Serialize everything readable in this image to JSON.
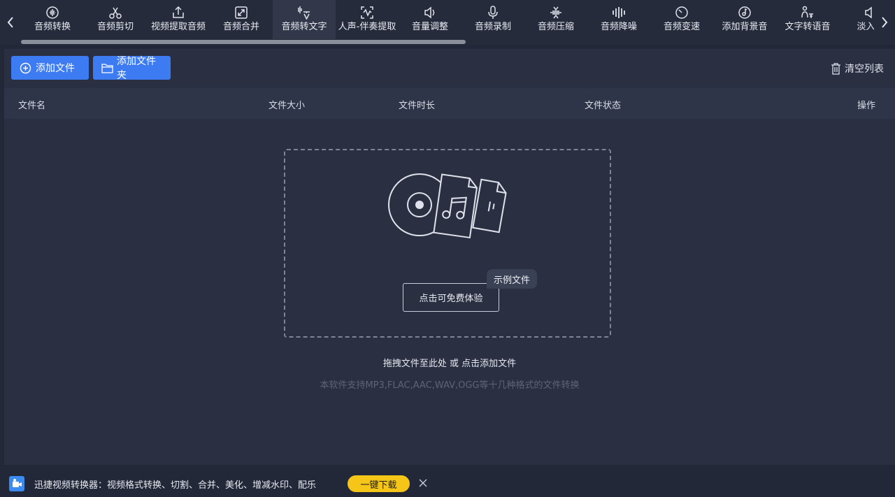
{
  "toolbar": {
    "tools": [
      {
        "label": "音频转换",
        "icon": "audio-convert-icon"
      },
      {
        "label": "音频剪切",
        "icon": "scissors-icon"
      },
      {
        "label": "视频提取音频",
        "icon": "export-icon"
      },
      {
        "label": "音频合并",
        "icon": "merge-icon"
      },
      {
        "label": "音频转文字",
        "icon": "speech-to-text-icon",
        "active": true
      },
      {
        "label": "人声-伴奏提取",
        "icon": "vocal-extract-icon"
      },
      {
        "label": "音量调整",
        "icon": "volume-icon"
      },
      {
        "label": "音频录制",
        "icon": "microphone-icon"
      },
      {
        "label": "音频压缩",
        "icon": "compress-icon"
      },
      {
        "label": "音频降噪",
        "icon": "denoise-icon"
      },
      {
        "label": "音频变速",
        "icon": "speed-icon"
      },
      {
        "label": "添加背景音",
        "icon": "music-disc-icon"
      },
      {
        "label": "文字转语音",
        "icon": "text-to-speech-icon"
      },
      {
        "label": "淡入淡",
        "icon": "fade-icon"
      }
    ]
  },
  "actions": {
    "add_file": "添加文件",
    "add_folder": "添加文件夹",
    "clear_list": "清空列表"
  },
  "table": {
    "columns": [
      "文件名",
      "文件大小",
      "文件时长",
      "文件状态",
      "操作"
    ]
  },
  "dropzone": {
    "trial_button": "点击可免费体验",
    "sample_badge": "示例文件",
    "hint": "拖拽文件至此处 或 点击添加文件",
    "formats": "本软件支持MP3,FLAC,AAC,WAV,OGG等十几种格式的文件转换"
  },
  "ad": {
    "text": "迅捷视频转换器：视频格式转换、切割、合并、美化、增减水印、配乐",
    "download": "一键下载"
  },
  "colors": {
    "accent": "#3d7bf2",
    "download": "#f5c518",
    "background": "#232838",
    "panel": "#2a3042"
  }
}
